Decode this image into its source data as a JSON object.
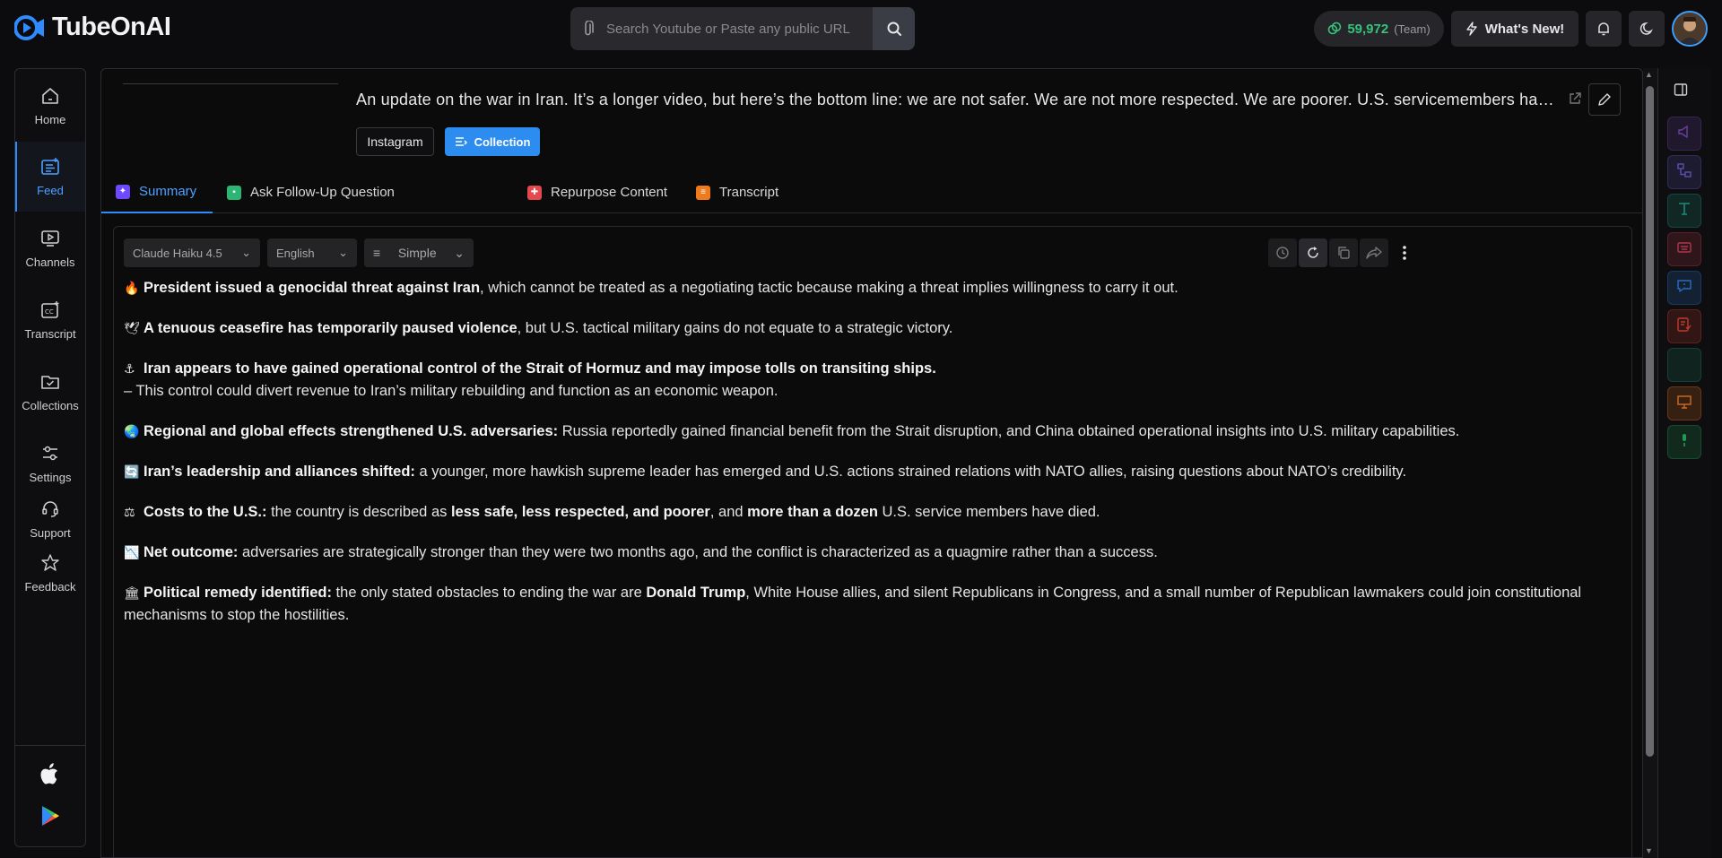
{
  "brand": {
    "name": "TubeOnAI"
  },
  "search": {
    "placeholder": "Search Youtube or Paste any public URL"
  },
  "header": {
    "credits_value": "59,972",
    "credits_label": "(Team)",
    "whats_new_label": "What's New!"
  },
  "sidebar": {
    "items": [
      {
        "label": "Home",
        "icon": "home-icon"
      },
      {
        "label": "Feed",
        "icon": "feed-icon",
        "active": true
      },
      {
        "label": "Channels",
        "icon": "channels-icon"
      },
      {
        "label": "Transcript",
        "icon": "transcript-icon"
      },
      {
        "label": "Collections",
        "icon": "collections-icon"
      },
      {
        "label": "Settings",
        "icon": "settings-icon"
      },
      {
        "label": "Support",
        "icon": "support-icon"
      },
      {
        "label": "Feedback",
        "icon": "feedback-icon"
      }
    ],
    "store_icons": [
      "apple-icon",
      "google-play-icon"
    ]
  },
  "video": {
    "title": "An update on the war in Iran. It’s a longer video, but here’s the bottom line: we are not safer. We are not more respected. We are poorer. U.S. servicemembers have died.",
    "chips": {
      "source": "Instagram",
      "collection": "Collection"
    }
  },
  "tabs": [
    {
      "label": "Summary",
      "active": true,
      "color": "#6d4aff"
    },
    {
      "label": "Ask Follow-Up Question",
      "color": "#2bb673"
    },
    {
      "label": "Repurpose Content",
      "color": "#e5484d"
    },
    {
      "label": "Transcript",
      "color": "#f07a1a"
    }
  ],
  "controls": {
    "model": "Claude Haiku 4.5",
    "language": "English",
    "style": "Simple"
  },
  "summary": {
    "b1": {
      "emoji": "🔥",
      "bold": "President issued a genocidal threat against Iran",
      "text": ", which cannot be treated as a negotiating tactic because making a threat implies willingness to carry it out."
    },
    "b2": {
      "emoji": "🕊",
      "bold": "A tenuous ceasefire has temporarily paused violence",
      "text": ", but U.S. tactical military gains do not equate to a strategic victory."
    },
    "b3": {
      "emoji": "⚓",
      "bold": "Iran appears to have gained operational control of the Strait of Hormuz and may impose tolls on transiting ships.",
      "sub": "– This control could divert revenue to Iran’s military rebuilding and function as an economic weapon."
    },
    "b4": {
      "emoji": "🌏",
      "bold": "Regional and global effects strengthened U.S. adversaries:",
      "text": " Russia reportedly gained financial benefit from the Strait disruption, and China obtained operational insights into U.S. military capabilities."
    },
    "b5": {
      "emoji": "🔄",
      "bold": "Iran’s leadership and alliances shifted:",
      "text": " a younger, more hawkish supreme leader has emerged and U.S. actions strained relations with NATO allies, raising questions about NATO’s credibility."
    },
    "b6": {
      "emoji": "⚖",
      "bold": "Costs to the U.S.:",
      "t1": " the country is described as ",
      "bold2": "less safe, less respected, and poorer",
      "t2": ", and ",
      "bold3": "more than a dozen",
      "t3": " U.S. service members have died."
    },
    "b7": {
      "emoji": "📉",
      "bold": "Net outcome:",
      "text": " adversaries are strategically stronger than they were two months ago, and the conflict is characterized as a quagmire rather than a success."
    },
    "b8": {
      "emoji": "🏛",
      "bold": "Political remedy identified:",
      "t1": " the only stated obstacles to ending the war are ",
      "bold2": "Donald Trump",
      "t2": ", White House allies, and silent Republicans in Congress, and a small number of Republican lawmakers could join constitutional mechanisms to stop the hostilities."
    }
  },
  "right_rail": [
    {
      "icon": "megaphone-icon",
      "color": "#6b3fa0"
    },
    {
      "icon": "flowchart-icon",
      "color": "#5a4fb0"
    },
    {
      "icon": "text-format-icon",
      "color": "#1f8a7a"
    },
    {
      "icon": "keyboard-icon",
      "color": "#b0354a"
    },
    {
      "icon": "chat-icon",
      "color": "#2a6cc0"
    },
    {
      "icon": "quiz-icon",
      "color": "#c0392b"
    },
    {
      "icon": "blank-card-icon",
      "color": "#1e7a5a"
    },
    {
      "icon": "presentation-icon",
      "color": "#d26a1e"
    },
    {
      "icon": "microphone-icon",
      "color": "#1f9a55"
    }
  ]
}
